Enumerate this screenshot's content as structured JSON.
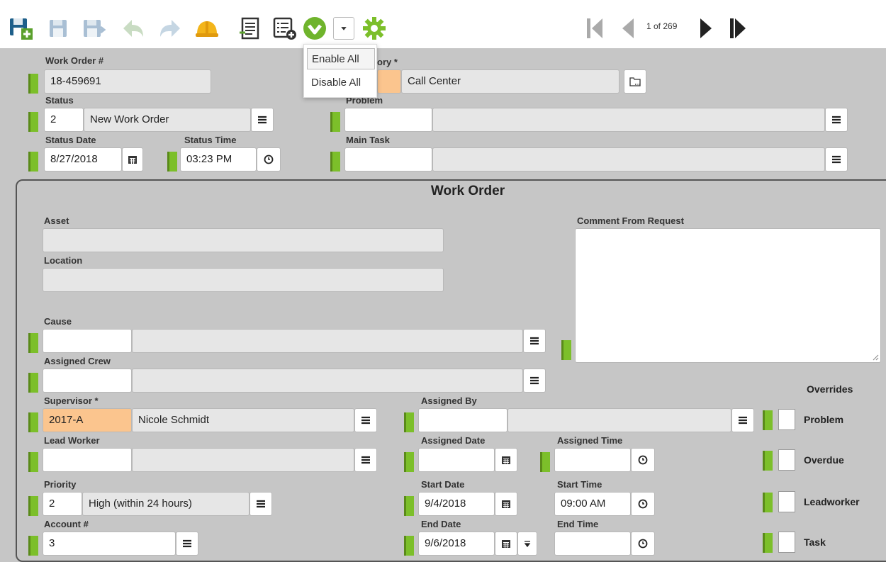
{
  "toolbar": {
    "icons": [
      "save-new-icon",
      "save-icon",
      "save-forward-icon",
      "undo-icon",
      "redo-icon",
      "hard-hat-icon",
      "notes-icon",
      "add-list-icon",
      "enable-disable-icon",
      "dropdown-caret-icon",
      "settings-gear-icon"
    ],
    "pager": {
      "text": "1 of 269"
    },
    "menu": {
      "enable": "Enable All",
      "disable": "Disable All"
    }
  },
  "header": {
    "work_order": {
      "label": "Work Order #",
      "value": "18-459691"
    },
    "category": {
      "label": "ory *",
      "value": "Call Center"
    },
    "status": {
      "label": "Status",
      "code": "2",
      "value": "New Work Order"
    },
    "problem": {
      "label": "Problem",
      "code": "",
      "value": ""
    },
    "status_date": {
      "label": "Status Date",
      "value": "8/27/2018"
    },
    "status_time": {
      "label": "Status Time",
      "value": "03:23 PM"
    },
    "main_task": {
      "label": "Main Task",
      "code": "",
      "value": ""
    }
  },
  "section": {
    "title": "Work Order",
    "asset": {
      "label": "Asset",
      "value": ""
    },
    "location": {
      "label": "Location",
      "value": ""
    },
    "comment": {
      "label": "Comment From Request",
      "value": ""
    },
    "cause": {
      "label": "Cause",
      "code": "",
      "value": ""
    },
    "assigned_crew": {
      "label": "Assigned Crew",
      "code": "",
      "value": ""
    },
    "supervisor": {
      "label": "Supervisor *",
      "code": "2017-A",
      "value": "Nicole Schmidt"
    },
    "assigned_by": {
      "label": "Assigned By",
      "code": "",
      "value": ""
    },
    "lead_worker": {
      "label": "Lead Worker",
      "code": "",
      "value": ""
    },
    "assigned_date": {
      "label": "Assigned Date",
      "value": ""
    },
    "assigned_time": {
      "label": "Assigned Time",
      "value": ""
    },
    "priority": {
      "label": "Priority",
      "code": "2",
      "value": "High (within 24 hours)"
    },
    "start_date": {
      "label": "Start Date",
      "value": "9/4/2018"
    },
    "start_time": {
      "label": "Start Time",
      "value": "09:00 AM"
    },
    "account": {
      "label": "Account #",
      "value": "3"
    },
    "end_date": {
      "label": "End Date",
      "value": "9/6/2018"
    },
    "end_time": {
      "label": "End Time",
      "value": ""
    },
    "overrides": {
      "title": "Overrides",
      "items": [
        "Problem",
        "Overdue",
        "Leadworker",
        "Task"
      ]
    }
  },
  "colors": {
    "required_marker": "#7cbf2a",
    "required_field": "#fbc58e",
    "background": "#c6c6c6"
  }
}
